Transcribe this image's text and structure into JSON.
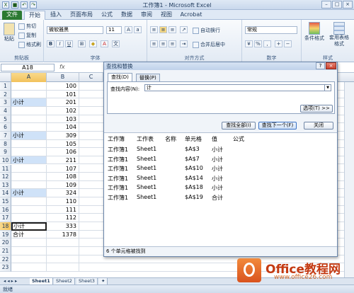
{
  "window": {
    "title": "工作簿1 - Microsoft Excel",
    "qat_icons": [
      "excel-icon",
      "save-icon",
      "undo-icon",
      "redo-icon"
    ]
  },
  "tabs": [
    "文件",
    "开始",
    "插入",
    "页面布局",
    "公式",
    "数据",
    "审阅",
    "视图",
    "Acrobat"
  ],
  "ribbon": {
    "clipboard": {
      "paste": "粘贴",
      "cut": "剪切",
      "copy": "复制",
      "format_painter": "格式刷",
      "label": "剪贴板"
    },
    "font": {
      "name": "微软雅黑",
      "size": "11",
      "label": "字体",
      "bold": "B",
      "italic": "I",
      "underline": "U"
    },
    "align": {
      "wrap": "自动换行",
      "merge": "合并后居中",
      "label": "对齐方式"
    },
    "number": {
      "format": "常规",
      "label": "数字"
    },
    "styles": {
      "cond": "条件格式",
      "table": "套用表格格式",
      "label": "样式"
    }
  },
  "formula_bar": {
    "name_box": "A18",
    "fx": "fx",
    "value": ""
  },
  "columns": {
    "row_header": "",
    "a": "A",
    "b": "B",
    "c": "C"
  },
  "rows": [
    {
      "n": "1",
      "a": "",
      "b": "100",
      "hl": false
    },
    {
      "n": "2",
      "a": "",
      "b": "101",
      "hl": false
    },
    {
      "n": "3",
      "a": "小计",
      "b": "201",
      "hl": true
    },
    {
      "n": "4",
      "a": "",
      "b": "102",
      "hl": false
    },
    {
      "n": "5",
      "a": "",
      "b": "103",
      "hl": false
    },
    {
      "n": "6",
      "a": "",
      "b": "104",
      "hl": false
    },
    {
      "n": "7",
      "a": "小计",
      "b": "309",
      "hl": true
    },
    {
      "n": "8",
      "a": "",
      "b": "105",
      "hl": false
    },
    {
      "n": "9",
      "a": "",
      "b": "106",
      "hl": false
    },
    {
      "n": "10",
      "a": "小计",
      "b": "211",
      "hl": true
    },
    {
      "n": "11",
      "a": "",
      "b": "107",
      "hl": false
    },
    {
      "n": "12",
      "a": "",
      "b": "108",
      "hl": false
    },
    {
      "n": "13",
      "a": "",
      "b": "109",
      "hl": false
    },
    {
      "n": "14",
      "a": "小计",
      "b": "324",
      "hl": true
    },
    {
      "n": "15",
      "a": "",
      "b": "110",
      "hl": false
    },
    {
      "n": "16",
      "a": "",
      "b": "111",
      "hl": false
    },
    {
      "n": "17",
      "a": "",
      "b": "112",
      "hl": false
    },
    {
      "n": "18",
      "a": "小计",
      "b": "333",
      "hl": false,
      "active": true
    },
    {
      "n": "19",
      "a": "合计",
      "b": "1378",
      "hl": false
    },
    {
      "n": "20",
      "a": "",
      "b": "",
      "hl": false
    },
    {
      "n": "21",
      "a": "",
      "b": "",
      "hl": false
    },
    {
      "n": "22",
      "a": "",
      "b": "",
      "hl": false
    },
    {
      "n": "23",
      "a": "",
      "b": "",
      "hl": false
    }
  ],
  "sheets": [
    "Sheet1",
    "Sheet2",
    "Sheet3"
  ],
  "status": "就绪",
  "dialog": {
    "title": "查找和替换",
    "help": "?",
    "close": "×",
    "tab_find": "查找(D)",
    "tab_replace": "替换(P)",
    "find_label": "查找内容(N):",
    "find_value": "计",
    "options": "选项(T) >>",
    "find_all": "查找全部(I)",
    "find_next": "查找下一个(F)",
    "close_btn": "关闭",
    "headers": [
      "工作簿",
      "工作表",
      "名称",
      "单元格",
      "值",
      "公式"
    ],
    "results": [
      [
        "工作簿1",
        "Sheet1",
        "",
        "$A$3",
        "小计",
        ""
      ],
      [
        "工作簿1",
        "Sheet1",
        "",
        "$A$7",
        "小计",
        ""
      ],
      [
        "工作簿1",
        "Sheet1",
        "",
        "$A$10",
        "小计",
        ""
      ],
      [
        "工作簿1",
        "Sheet1",
        "",
        "$A$14",
        "小计",
        ""
      ],
      [
        "工作簿1",
        "Sheet1",
        "",
        "$A$18",
        "小计",
        ""
      ],
      [
        "工作簿1",
        "Sheet1",
        "",
        "$A$19",
        "合计",
        ""
      ]
    ],
    "found": "6 个单元格被找到"
  },
  "watermark": {
    "brand": "Office教程网",
    "url": "www.office26.com"
  }
}
